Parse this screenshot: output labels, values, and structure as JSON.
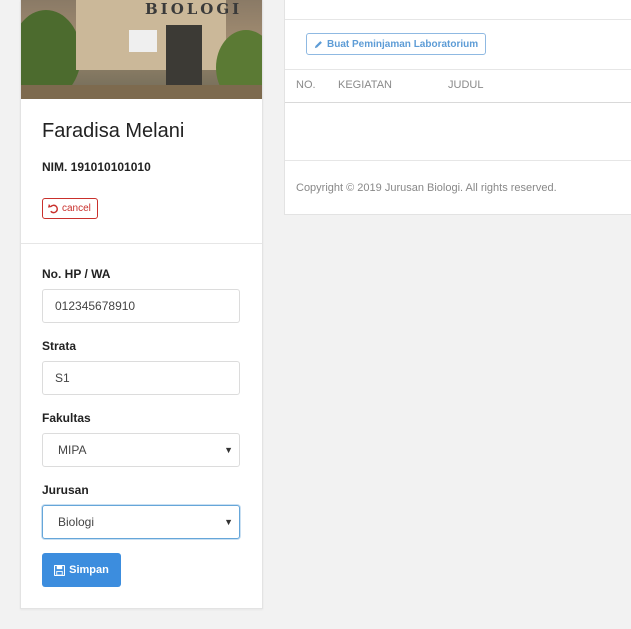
{
  "profile": {
    "photo_sign": "BIOLOGI",
    "name": "Faradisa Melani",
    "nim": "NIM. 191010101010",
    "cancel_label": "cancel"
  },
  "form": {
    "phone_label": "No. HP / WA",
    "phone_value": "012345678910",
    "strata_label": "Strata",
    "strata_value": "S1",
    "fakultas_label": "Fakultas",
    "fakultas_value": "MIPA",
    "jurusan_label": "Jurusan",
    "jurusan_value": "Biologi",
    "save_label": "Simpan"
  },
  "main": {
    "create_label": "Buat Peminjaman Laboratorium",
    "columns": [
      "NO.",
      "KEGIATAN",
      "JUDUL"
    ],
    "footer": "Copyright © 2019 Jurusan Biologi. All rights reserved."
  },
  "colors": {
    "primary": "#3c8dde",
    "danger": "#c9302c",
    "outline_primary": "#8fb9e2"
  },
  "icons": [
    "undo-icon",
    "save-icon",
    "pencil-icon",
    "caret-down-icon"
  ]
}
